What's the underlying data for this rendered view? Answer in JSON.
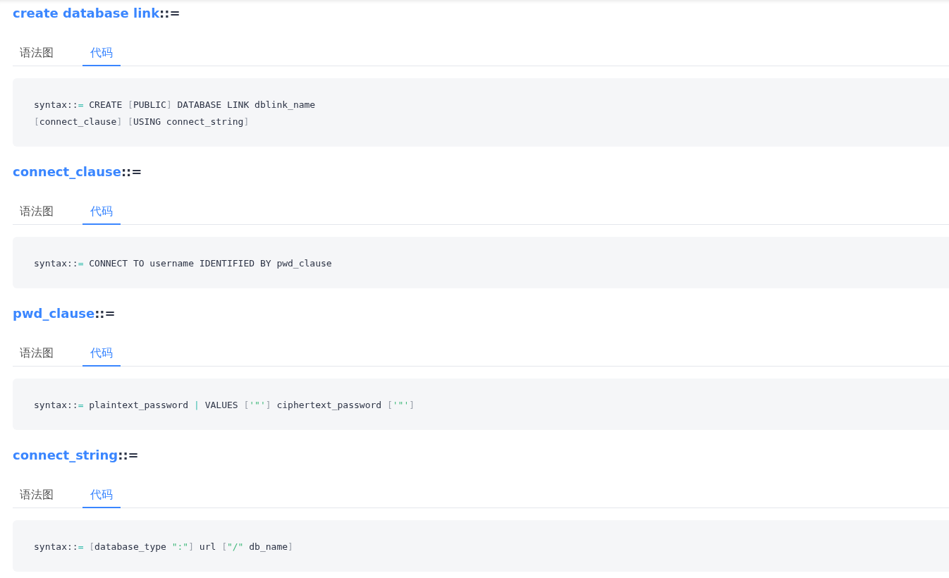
{
  "sections": [
    {
      "title": {
        "name": "create database link",
        "suffix": "::="
      },
      "tabs": [
        {
          "label": "语法图",
          "selected": false
        },
        {
          "label": "代码",
          "selected": true
        }
      ],
      "code_lines": [
        [
          {
            "kind": "plain",
            "text": "syntax::"
          },
          {
            "kind": "op",
            "text": "="
          },
          {
            "kind": "plain",
            "text": " CREATE "
          },
          {
            "kind": "bracket",
            "text": "["
          },
          {
            "kind": "plain",
            "text": "PUBLIC"
          },
          {
            "kind": "bracket",
            "text": "]"
          },
          {
            "kind": "plain",
            "text": " DATABASE LINK dblink_name"
          }
        ],
        [
          {
            "kind": "bracket",
            "text": "["
          },
          {
            "kind": "plain",
            "text": "connect_clause"
          },
          {
            "kind": "bracket",
            "text": "] "
          },
          {
            "kind": "bracket",
            "text": "["
          },
          {
            "kind": "plain",
            "text": "USING connect_string"
          },
          {
            "kind": "bracket",
            "text": "]"
          }
        ]
      ]
    },
    {
      "title": {
        "name": "connect_clause",
        "suffix": "::="
      },
      "tabs": [
        {
          "label": "语法图",
          "selected": false
        },
        {
          "label": "代码",
          "selected": true
        }
      ],
      "code_lines": [
        [
          {
            "kind": "plain",
            "text": "syntax::"
          },
          {
            "kind": "op",
            "text": "="
          },
          {
            "kind": "plain",
            "text": " CONNECT TO username IDENTIFIED BY pwd_clause"
          }
        ]
      ]
    },
    {
      "title": {
        "name": "pwd_clause",
        "suffix": "::="
      },
      "tabs": [
        {
          "label": "语法图",
          "selected": false
        },
        {
          "label": "代码",
          "selected": true
        }
      ],
      "code_lines": [
        [
          {
            "kind": "plain",
            "text": "syntax::"
          },
          {
            "kind": "op",
            "text": "="
          },
          {
            "kind": "plain",
            "text": " plaintext_password "
          },
          {
            "kind": "op",
            "text": "|"
          },
          {
            "kind": "plain",
            "text": " VALUES "
          },
          {
            "kind": "bracket",
            "text": "["
          },
          {
            "kind": "string",
            "text": "'\"'"
          },
          {
            "kind": "bracket",
            "text": "]"
          },
          {
            "kind": "plain",
            "text": " ciphertext_password "
          },
          {
            "kind": "bracket",
            "text": "["
          },
          {
            "kind": "string",
            "text": "'\"'"
          },
          {
            "kind": "bracket",
            "text": "]"
          }
        ]
      ]
    },
    {
      "title": {
        "name": "connect_string",
        "suffix": "::="
      },
      "tabs": [
        {
          "label": "语法图",
          "selected": false
        },
        {
          "label": "代码",
          "selected": true
        }
      ],
      "code_lines": [
        [
          {
            "kind": "plain",
            "text": "syntax::"
          },
          {
            "kind": "op",
            "text": "= "
          },
          {
            "kind": "bracket",
            "text": "["
          },
          {
            "kind": "plain",
            "text": "database_type "
          },
          {
            "kind": "string",
            "text": "\":\""
          },
          {
            "kind": "bracket",
            "text": "]"
          },
          {
            "kind": "plain",
            "text": " url "
          },
          {
            "kind": "bracket",
            "text": "["
          },
          {
            "kind": "string",
            "text": "\"/\""
          },
          {
            "kind": "plain",
            "text": " db_name"
          },
          {
            "kind": "bracket",
            "text": "]"
          }
        ]
      ]
    }
  ]
}
